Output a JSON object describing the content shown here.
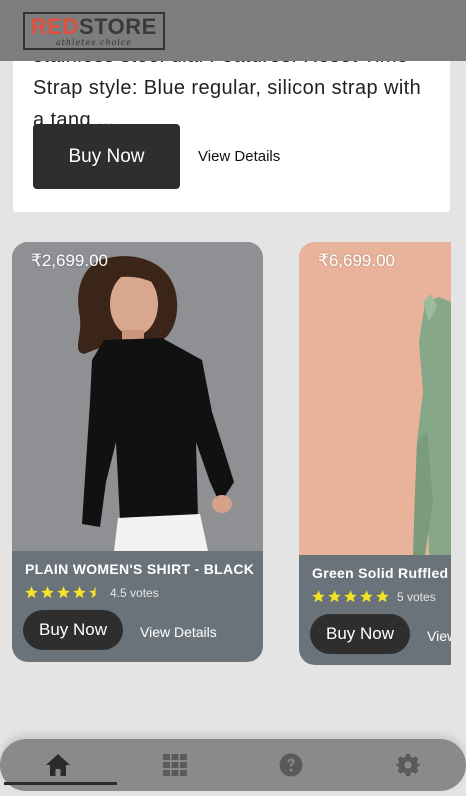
{
  "header": {
    "logo_red": "RED",
    "logo_dark": "STORE",
    "logo_tagline": "athletes choice"
  },
  "top_card": {
    "description": "stainless steel dial Features: Reset Time Strap style: Blue regular, silicon strap with a tang ...",
    "buy_label": "Buy Now",
    "view_label": "View Details"
  },
  "products": [
    {
      "price": "₹2,699.00",
      "name": "PLAIN WOMEN'S SHIRT - BLACK",
      "rating": 4.5,
      "votes": "4.5 votes",
      "buy_label": "Buy Now",
      "view_label": "View Details"
    },
    {
      "price": "₹6,699.00",
      "name": "Green Solid Ruffled",
      "rating": 5,
      "votes": "5 votes",
      "buy_label": "Buy Now",
      "view_label": "View"
    }
  ],
  "nav": {
    "items": [
      "home-icon",
      "apps-grid-icon",
      "help-icon",
      "settings-gear-icon"
    ],
    "active": "home-icon"
  },
  "colors": {
    "header_bg": "#7d7d7d",
    "logo_red": "#e0503f",
    "button_dark": "#2e2e2e",
    "card_footer": "#6b737a",
    "star": "#f5e02a",
    "nav_bg": "#8a8a8a"
  }
}
